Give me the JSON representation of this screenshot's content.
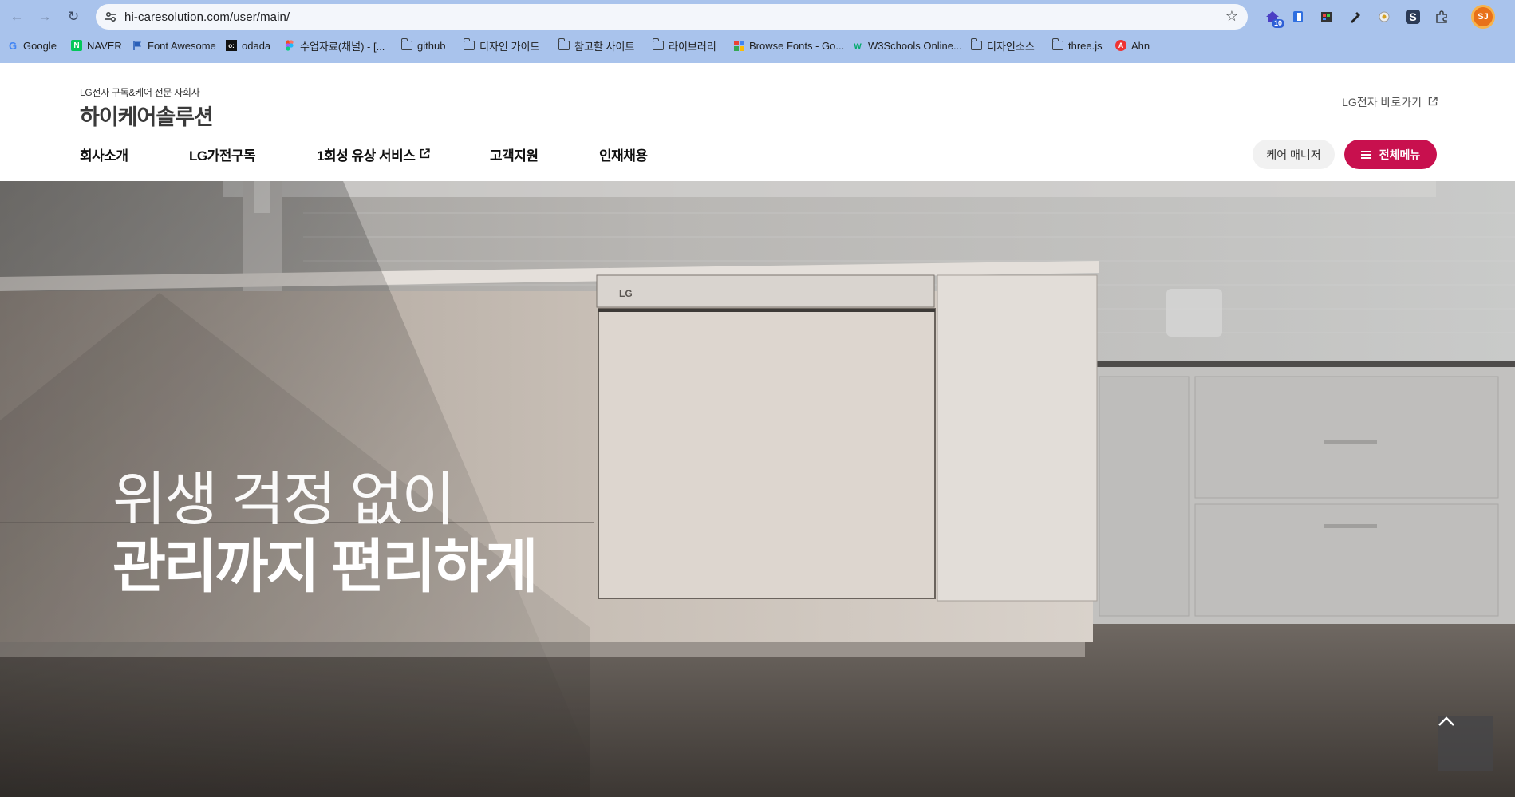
{
  "browser": {
    "url": "hi-caresolution.com/user/main/",
    "extension_badge": "10",
    "profile_initials": "SJ",
    "bookmarks": [
      {
        "label": "Google",
        "icon": "google-g-icon"
      },
      {
        "label": "NAVER",
        "icon": "naver-n-icon"
      },
      {
        "label": "Font Awesome",
        "icon": "flag-icon"
      },
      {
        "label": "odada",
        "icon": "odada-icon"
      },
      {
        "label": "수업자료(채널) - [...",
        "icon": "figma-icon"
      },
      {
        "label": "github",
        "icon": "folder-icon"
      },
      {
        "label": "디자인 가이드",
        "icon": "folder-icon"
      },
      {
        "label": "참고할 사이트",
        "icon": "folder-icon"
      },
      {
        "label": "라이브러리",
        "icon": "folder-icon"
      },
      {
        "label": "Browse Fonts - Go...",
        "icon": "google-fonts-icon"
      },
      {
        "label": "W3Schools Online...",
        "icon": "w3schools-icon"
      },
      {
        "label": "디자인소스",
        "icon": "folder-icon"
      },
      {
        "label": "three.js",
        "icon": "folder-icon"
      },
      {
        "label": "Ahn",
        "icon": "a-circle-icon"
      }
    ]
  },
  "header": {
    "logo_sub": "LG전자 구독&케어 전문 자회사",
    "logo_main": "하이케어솔루션",
    "lg_link": "LG전자 바로가기",
    "nav": [
      "회사소개",
      "LG가전구독",
      "1회성 유상 서비스",
      "고객지원",
      "인재채용"
    ],
    "care_manager_button": "케어 매니저",
    "all_menu_button": "전체메뉴",
    "brand_color": "#c8104e"
  },
  "hero": {
    "line1": "위생 걱정 없이",
    "line2": "관리까지 편리하게",
    "appliance_badge": "LG"
  }
}
